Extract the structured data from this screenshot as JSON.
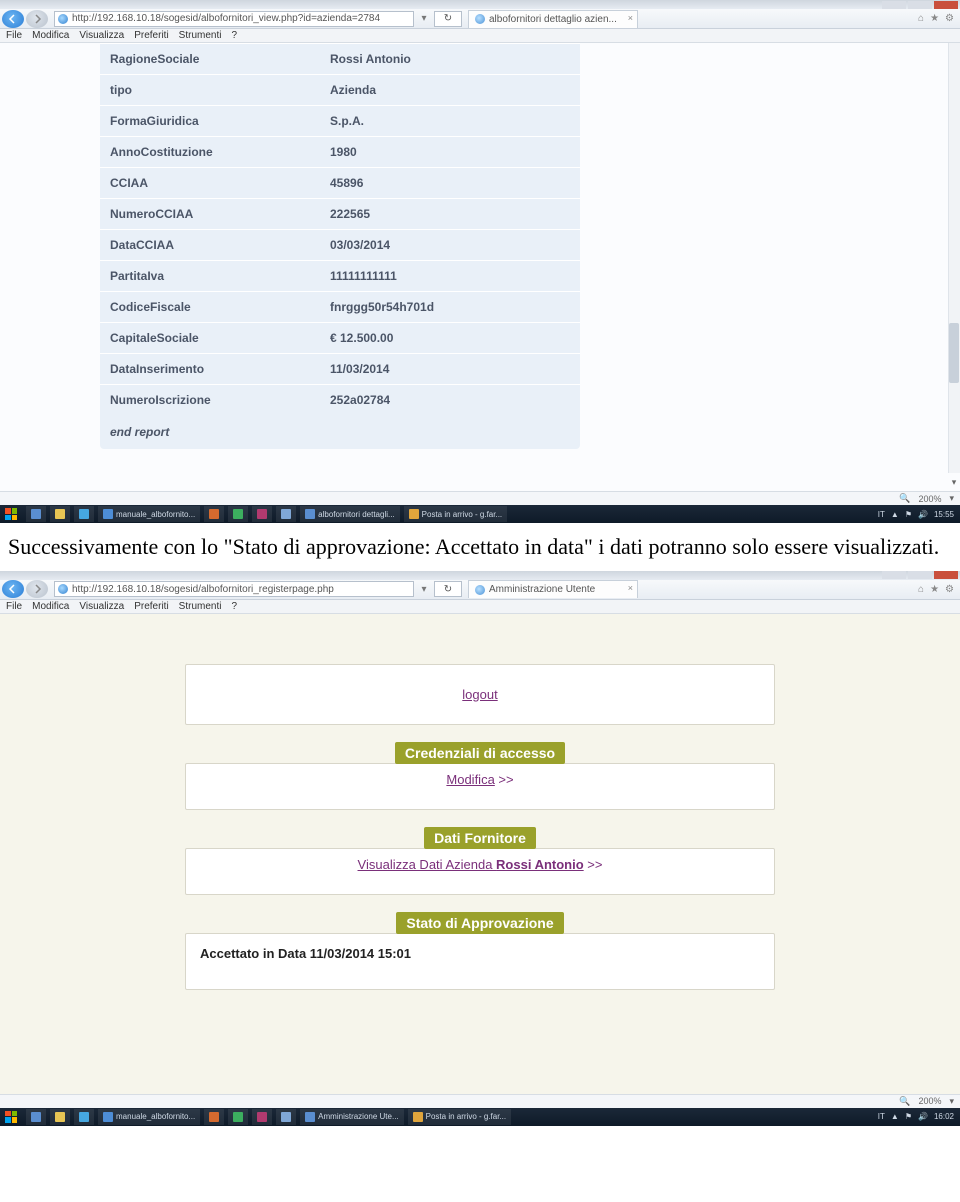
{
  "screenshot1": {
    "url": "http://192.168.10.18/sogesid/albofornitori_view.php?id=azienda=2784",
    "tab_title": "albofornitori dettaglio azien...",
    "menubar": [
      "File",
      "Modifica",
      "Visualizza",
      "Preferiti",
      "Strumenti",
      "?"
    ],
    "rows": [
      {
        "k": "RagioneSociale",
        "v": "Rossi Antonio"
      },
      {
        "k": "tipo",
        "v": "Azienda"
      },
      {
        "k": "FormaGiuridica",
        "v": "S.p.A."
      },
      {
        "k": "AnnoCostituzione",
        "v": "1980"
      },
      {
        "k": "CCIAA",
        "v": "45896"
      },
      {
        "k": "NumeroCCIAA",
        "v": "222565"
      },
      {
        "k": "DataCCIAA",
        "v": "03/03/2014"
      },
      {
        "k": "PartitaIva",
        "v": "11111111111"
      },
      {
        "k": "CodiceFiscale",
        "v": "fnrggg50r54h701d"
      },
      {
        "k": "CapitaleSociale",
        "v": "€ 12.500.00"
      },
      {
        "k": "DataInserimento",
        "v": "11/03/2014"
      },
      {
        "k": "NumeroIscrizione",
        "v": "252a02784"
      }
    ],
    "end_report": "end report",
    "zoom": "200%",
    "taskbar_items": [
      "manuale_albofornito...",
      "",
      "",
      "",
      "",
      "albofornitori dettagli...",
      "Posta in arrivo - g.far..."
    ],
    "tray_lang": "IT",
    "clock": "15:55"
  },
  "explain_text": "Successivamente con lo \"Stato di approvazione: Accettato in data\" i dati potranno solo essere visualizzati.",
  "screenshot2": {
    "url": "http://192.168.10.18/sogesid/albofornitori_registerpage.php",
    "tab_title": "Amministrazione Utente",
    "menubar": [
      "File",
      "Modifica",
      "Visualizza",
      "Preferiti",
      "Strumenti",
      "?"
    ],
    "logout_label": "logout",
    "badge_credentials": "Credenziali di accesso",
    "modifica_label": "Modifica",
    "badge_supplier": "Dati Fornitore",
    "visualizza_prefix": "Visualizza Dati Azienda ",
    "visualizza_company": "Rossi Antonio",
    "badge_status": "Stato di Approvazione",
    "status_text": "Accettato in Data 11/03/2014 15:01",
    "zoom": "200%",
    "taskbar_items": [
      "manuale_albofornito...",
      "",
      "",
      "",
      "",
      "Amministrazione Ute...",
      "Posta in arrivo - g.far..."
    ],
    "tray_lang": "IT",
    "clock": "16:02"
  }
}
